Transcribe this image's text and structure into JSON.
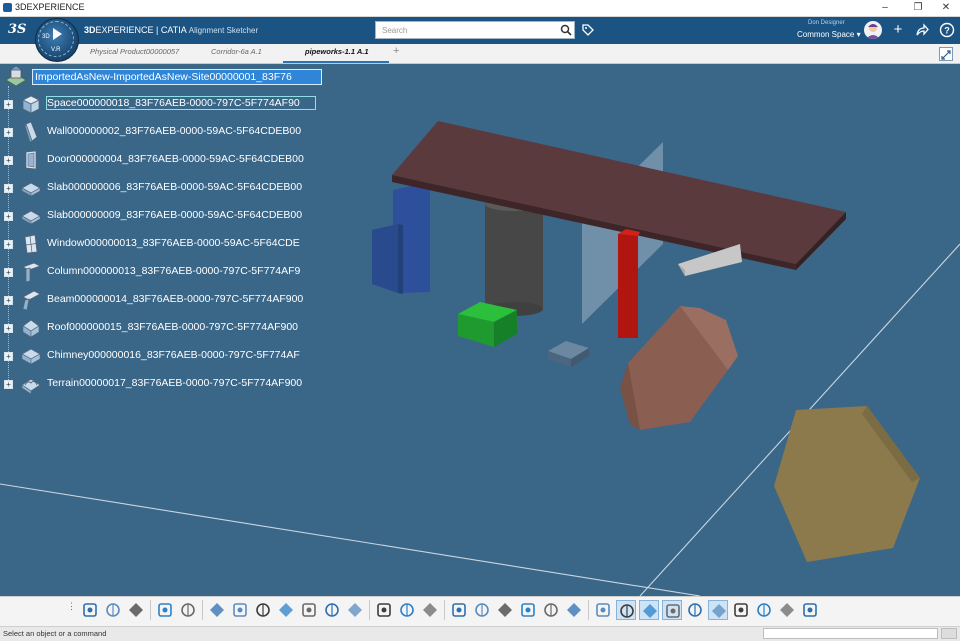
{
  "window": {
    "title": "3DEXPERIENCE",
    "controls": [
      "minimize",
      "restore",
      "close"
    ]
  },
  "header": {
    "logo": "3S",
    "compass": {
      "label_3d": "3D",
      "label_vr": "V.R"
    },
    "brand_bold": "3D",
    "brand_rest": "EXPERIENCE",
    "app_separator": " | ",
    "app_name": "CATIA",
    "app_sub": "Alignment Sketcher",
    "search_placeholder": "Search",
    "user_name": "Don Designer",
    "space_name": "Common Space",
    "icons": [
      "search-icon",
      "tag-icon",
      "avatar",
      "plus-icon",
      "share-icon",
      "help-icon"
    ]
  },
  "tabs": [
    {
      "label": "Physical Product00000057",
      "active": false
    },
    {
      "label": "Corridor-6a A.1",
      "active": false
    },
    {
      "label": "pipeworks-1.1 A.1",
      "active": true
    }
  ],
  "tab_add": "+",
  "tree": {
    "root": "ImportedAsNew-ImportedAsNew-Site00000001_83F76",
    "items": [
      {
        "label": "Space000000018_83F76AEB-0000-797C-5F774AF90",
        "icon": "space-icon",
        "selected": true
      },
      {
        "label": "Wall000000002_83F76AEB-0000-59AC-5F64CDEB00",
        "icon": "wall-icon",
        "selected": false
      },
      {
        "label": "Door000000004_83F76AEB-0000-59AC-5F64CDEB00",
        "icon": "door-icon",
        "selected": false
      },
      {
        "label": "Slab000000006_83F76AEB-0000-59AC-5F64CDEB00",
        "icon": "slab-icon",
        "selected": false
      },
      {
        "label": "Slab000000009_83F76AEB-0000-59AC-5F64CDEB00",
        "icon": "slab-icon",
        "selected": false
      },
      {
        "label": "Window000000013_83F76AEB-0000-59AC-5F64CDE",
        "icon": "window-icon",
        "selected": false
      },
      {
        "label": "Column000000013_83F76AEB-0000-797C-5F774AF9",
        "icon": "column-icon",
        "selected": false
      },
      {
        "label": "Beam000000014_83F76AEB-0000-797C-5F774AF900",
        "icon": "beam-icon",
        "selected": false
      },
      {
        "label": "Roof000000015_83F76AEB-0000-797C-5F774AF900",
        "icon": "roof-icon",
        "selected": false
      },
      {
        "label": "Chimney000000016_83F76AEB-0000-797C-5F774AF",
        "icon": "chimney-icon",
        "selected": false
      },
      {
        "label": "Terrain00000017_83F76AEB-0000-797C-5F774AF900",
        "icon": "terrain-icon",
        "selected": false
      }
    ]
  },
  "colors": {
    "viewport_bg": "#3a6688",
    "header_bg": "#1b5382",
    "roof_slab": "#5a3a3c",
    "wall_blue": "#2e4f9b",
    "column_gray": "#4a4a4a",
    "window_glass": "#9db3c6",
    "beam_red": "#b0160f",
    "slab_light": "#c7c7c7",
    "chimney_green": "#1f9a2e",
    "small_box": "#55708a",
    "cylinder_brown": "#8a5f52",
    "terrain_olive": "#8c7a4d"
  },
  "toolbar": {
    "tools": [
      "cut-icon",
      "copy-icon",
      "paste-icon",
      "undo-icon",
      "fly-mode-icon",
      "publish-icon",
      "zoom-fit-icon",
      "view-cube-icon",
      "pan-icon",
      "rotate-icon",
      "look-at-icon",
      "zoom-icon",
      "walk-icon",
      "material-icon",
      "shading-icon",
      "cylinder-icon",
      "snapshot-icon",
      "explode-icon",
      "filter-icon",
      "measure-icon",
      "capture-icon",
      "multiview-icon",
      "grid-icon",
      "axis-icon",
      "align-icon",
      "sketch-icon",
      "dimension-icon",
      "constraint-icon",
      "layer-icon",
      "globe-icon",
      "tools-icon"
    ]
  },
  "status": {
    "message": "Select an object or a command"
  }
}
